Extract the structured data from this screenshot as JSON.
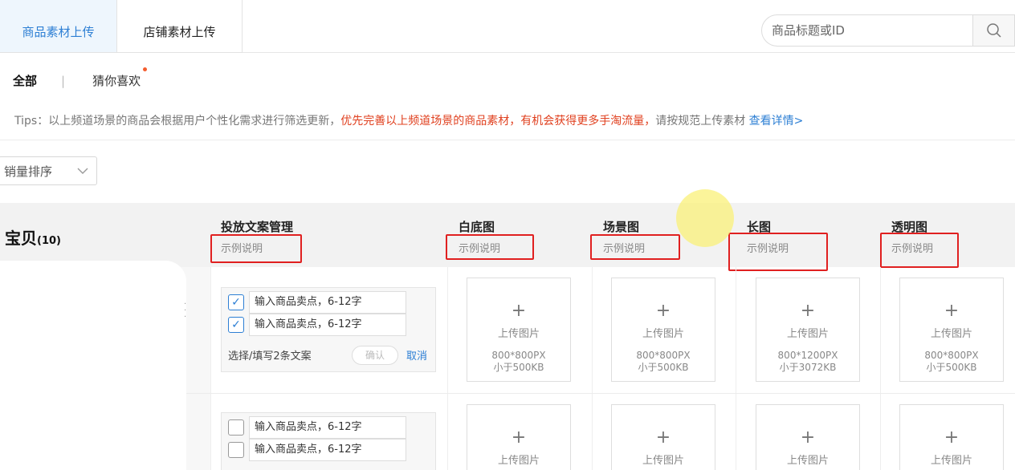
{
  "tabs": [
    {
      "label": "商品素材上传",
      "active": true
    },
    {
      "label": "店铺素材上传",
      "active": false
    }
  ],
  "search": {
    "placeholder": "商品标题或ID",
    "icon": "search-icon"
  },
  "subnav": {
    "all": "全部",
    "separator": "|",
    "guess": "猜你喜欢"
  },
  "tips": {
    "prefix": "Tips：以上频道场景的商品会根据用户个性化需求进行筛选更新，",
    "highlight": "优先完善以上频道场景的商品素材，有机会获得更多手淘流量，",
    "suffix": "请按规范上传素材 ",
    "link": "查看详情>"
  },
  "sort": {
    "label": "销量排序",
    "icon": "chevron-down-icon"
  },
  "table": {
    "baby_label": "宝贝",
    "baby_count": "(10)",
    "columns": [
      {
        "title": "投放文案管理",
        "sub": "示例说明"
      },
      {
        "title": "白底图",
        "sub": "示例说明"
      },
      {
        "title": "场景图",
        "sub": "示例说明"
      },
      {
        "title": "长图",
        "sub": "示例说明"
      },
      {
        "title": "透明图",
        "sub": "示例说明"
      }
    ]
  },
  "rows": [
    {
      "copy_placeholder_1": "输入商品卖点，6-12字",
      "copy_placeholder_2": "输入商品卖点，6-12字",
      "checked_1": true,
      "checked_2": true,
      "choose_text": "选择/填写2条文案",
      "confirm": "确认",
      "cancel": "取消",
      "uploads": [
        {
          "label": "上传图片",
          "spec": "800*800PX",
          "size": "小于500KB"
        },
        {
          "label": "上传图片",
          "spec": "800*800PX",
          "size": "小于500KB"
        },
        {
          "label": "上传图片",
          "spec": "800*1200PX",
          "size": "小于3072KB"
        },
        {
          "label": "上传图片",
          "spec": "800*800PX",
          "size": "小于500KB"
        }
      ]
    },
    {
      "copy_placeholder_1": "输入商品卖点，6-12字",
      "copy_placeholder_2": "输入商品卖点，6-12字",
      "checked_1": false,
      "checked_2": false,
      "uploads": [
        {
          "label": "上传图片"
        },
        {
          "label": "上传图片"
        },
        {
          "label": "上传图片"
        },
        {
          "label": "上传图片"
        }
      ]
    }
  ],
  "upload_plus": "+",
  "check_mark": "✓"
}
